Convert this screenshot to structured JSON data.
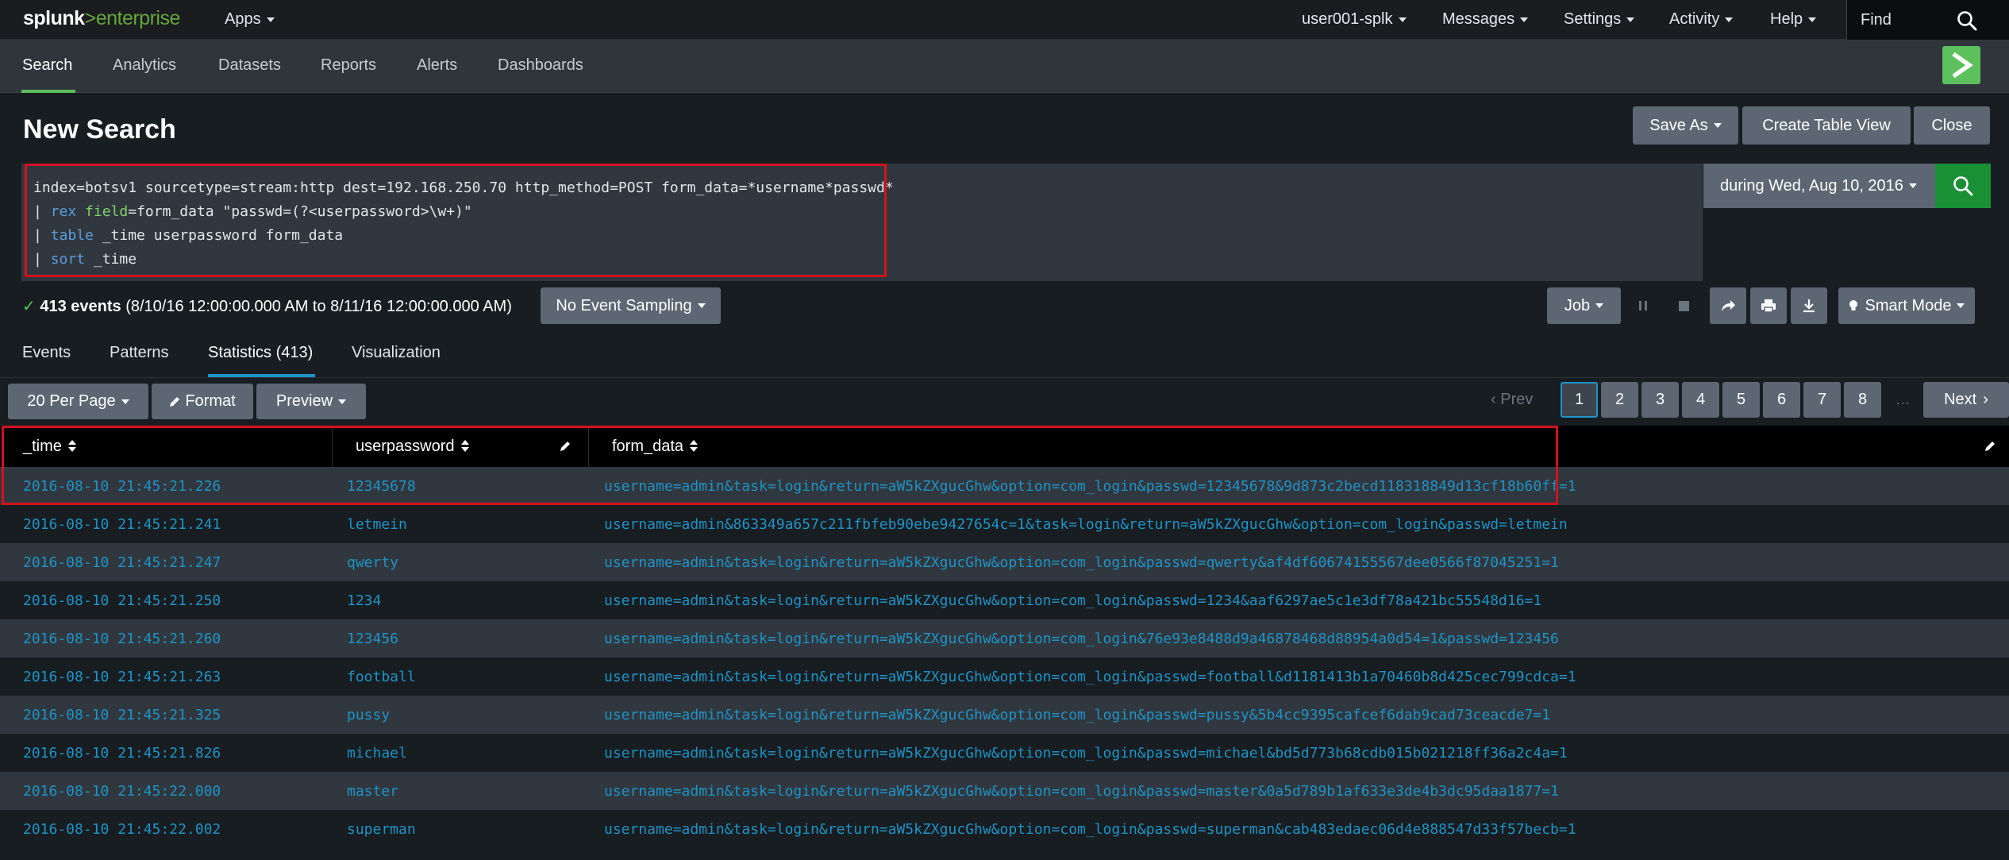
{
  "topbar": {
    "logo_brand": "splunk",
    "logo_sep": ">",
    "logo_product": "enterprise",
    "apps": "Apps",
    "user": "user001-splk",
    "messages": "Messages",
    "settings": "Settings",
    "activity": "Activity",
    "help": "Help",
    "find_placeholder": "Find"
  },
  "nav": {
    "tabs": [
      "Search",
      "Analytics",
      "Datasets",
      "Reports",
      "Alerts",
      "Dashboards"
    ]
  },
  "page": {
    "title": "New Search",
    "save_as": "Save As",
    "create_table_view": "Create Table View",
    "close": "Close"
  },
  "search": {
    "line1": "index=botsv1 sourcetype=stream:http dest=192.168.250.70 http_method=POST form_data=*username*passwd*",
    "line2_kw": "rex",
    "line2_arg": "field",
    "line2_rest": "=form_data \"passwd=(?<userpassword>\\w+)\"",
    "line3_kw": "table",
    "line3_rest": " _time userpassword form_data",
    "line4_kw": "sort",
    "line4_rest": " _time",
    "pipe": "| ",
    "time_range": "during Wed, Aug 10, 2016"
  },
  "status": {
    "count": "413 events",
    "range": "(8/10/16 12:00:00.000 AM to 8/11/16 12:00:00.000 AM)",
    "sampling": "No Event Sampling",
    "job": "Job",
    "mode": "Smart Mode"
  },
  "result_tabs": [
    "Events",
    "Patterns",
    "Statistics (413)",
    "Visualization"
  ],
  "controls": {
    "per_page": "20 Per Page",
    "format": "Format",
    "preview": "Preview",
    "prev": "Prev",
    "next": "Next",
    "pages": [
      "1",
      "2",
      "3",
      "4",
      "5",
      "6",
      "7",
      "8"
    ],
    "ellipsis": "…",
    "current_page": "1"
  },
  "table": {
    "columns": [
      "_time",
      "userpassword",
      "form_data"
    ],
    "rows": [
      [
        "2016-08-10 21:45:21.226",
        "12345678",
        "username=admin&task=login&return=aW5kZXgucGhw&option=com_login&passwd=12345678&9d873c2becd118318849d13cf18b60ff=1"
      ],
      [
        "2016-08-10 21:45:21.241",
        "letmein",
        "username=admin&863349a657c211fbfeb90ebe9427654c=1&task=login&return=aW5kZXgucGhw&option=com_login&passwd=letmein"
      ],
      [
        "2016-08-10 21:45:21.247",
        "qwerty",
        "username=admin&task=login&return=aW5kZXgucGhw&option=com_login&passwd=qwerty&af4df60674155567dee0566f87045251=1"
      ],
      [
        "2016-08-10 21:45:21.250",
        "1234",
        "username=admin&task=login&return=aW5kZXgucGhw&option=com_login&passwd=1234&aaf6297ae5c1e3df78a421bc55548d16=1"
      ],
      [
        "2016-08-10 21:45:21.260",
        "123456",
        "username=admin&task=login&return=aW5kZXgucGhw&option=com_login&76e93e8488d9a46878468d88954a0d54=1&passwd=123456"
      ],
      [
        "2016-08-10 21:45:21.263",
        "football",
        "username=admin&task=login&return=aW5kZXgucGhw&option=com_login&passwd=football&d1181413b1a70460b8d425cec799cdca=1"
      ],
      [
        "2016-08-10 21:45:21.325",
        "pussy",
        "username=admin&task=login&return=aW5kZXgucGhw&option=com_login&passwd=pussy&5b4cc9395cafcef6dab9cad73ceacde7=1"
      ],
      [
        "2016-08-10 21:45:21.826",
        "michael",
        "username=admin&task=login&return=aW5kZXgucGhw&option=com_login&passwd=michael&bd5d773b68cdb015b021218ff36a2c4a=1"
      ],
      [
        "2016-08-10 21:45:22.000",
        "master",
        "username=admin&task=login&return=aW5kZXgucGhw&option=com_login&passwd=master&0a5d789b1af633e3de4b3dc95daa1877=1"
      ],
      [
        "2016-08-10 21:45:22.002",
        "superman",
        "username=admin&task=login&return=aW5kZXgucGhw&option=com_login&passwd=superman&cab483edaec06d4e888547d33f57becb=1"
      ]
    ]
  },
  "colors": {
    "accent_green": "#5cc05c",
    "link_blue": "#1e93c6",
    "highlight_red": "#d0131f"
  }
}
